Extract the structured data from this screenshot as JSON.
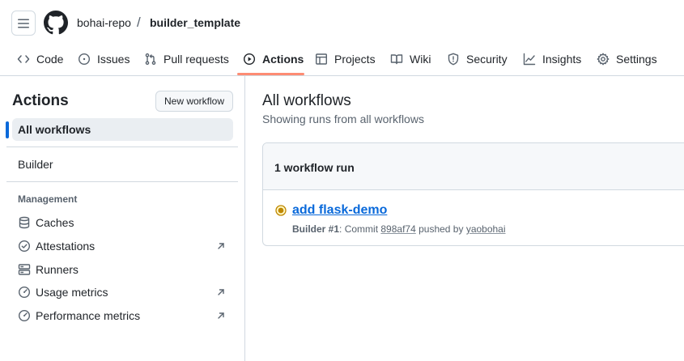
{
  "breadcrumb": {
    "owner": "bohai-repo",
    "separator": "/",
    "repo": "builder_template"
  },
  "tabs": [
    {
      "label": "Code",
      "icon": "code-icon"
    },
    {
      "label": "Issues",
      "icon": "issue-opened-icon"
    },
    {
      "label": "Pull requests",
      "icon": "git-pull-request-icon"
    },
    {
      "label": "Actions",
      "icon": "play-icon",
      "selected": true
    },
    {
      "label": "Projects",
      "icon": "table-icon"
    },
    {
      "label": "Wiki",
      "icon": "book-icon"
    },
    {
      "label": "Security",
      "icon": "shield-icon"
    },
    {
      "label": "Insights",
      "icon": "graph-icon"
    },
    {
      "label": "Settings",
      "icon": "gear-icon"
    }
  ],
  "sidebar": {
    "title": "Actions",
    "new_workflow_label": "New workflow",
    "all_workflows_label": "All workflows",
    "workflows": [
      "Builder"
    ],
    "management_label": "Management",
    "management_items": [
      {
        "label": "Caches",
        "icon": "database-icon"
      },
      {
        "label": "Attestations",
        "icon": "verified-icon",
        "external": true
      },
      {
        "label": "Runners",
        "icon": "server-icon"
      },
      {
        "label": "Usage metrics",
        "icon": "meter-icon",
        "external": true
      },
      {
        "label": "Performance metrics",
        "icon": "meter-icon",
        "external": true
      }
    ]
  },
  "main": {
    "title": "All workflows",
    "subtitle": "Showing runs from all workflows",
    "run_count_label": "1 workflow run",
    "runs": [
      {
        "title": "add flask-demo",
        "workflow_run": "Builder #1",
        "commit_prefix": ": Commit ",
        "commit": "898af74",
        "pushed_by_prefix": " pushed by ",
        "actor": "yaobohai",
        "status": "in-progress"
      }
    ]
  },
  "colors": {
    "accent_link": "#0969da",
    "selected_tab_underline": "#fd8c73",
    "status_in_progress": "#bf8700",
    "border": "#d1d9e0"
  }
}
